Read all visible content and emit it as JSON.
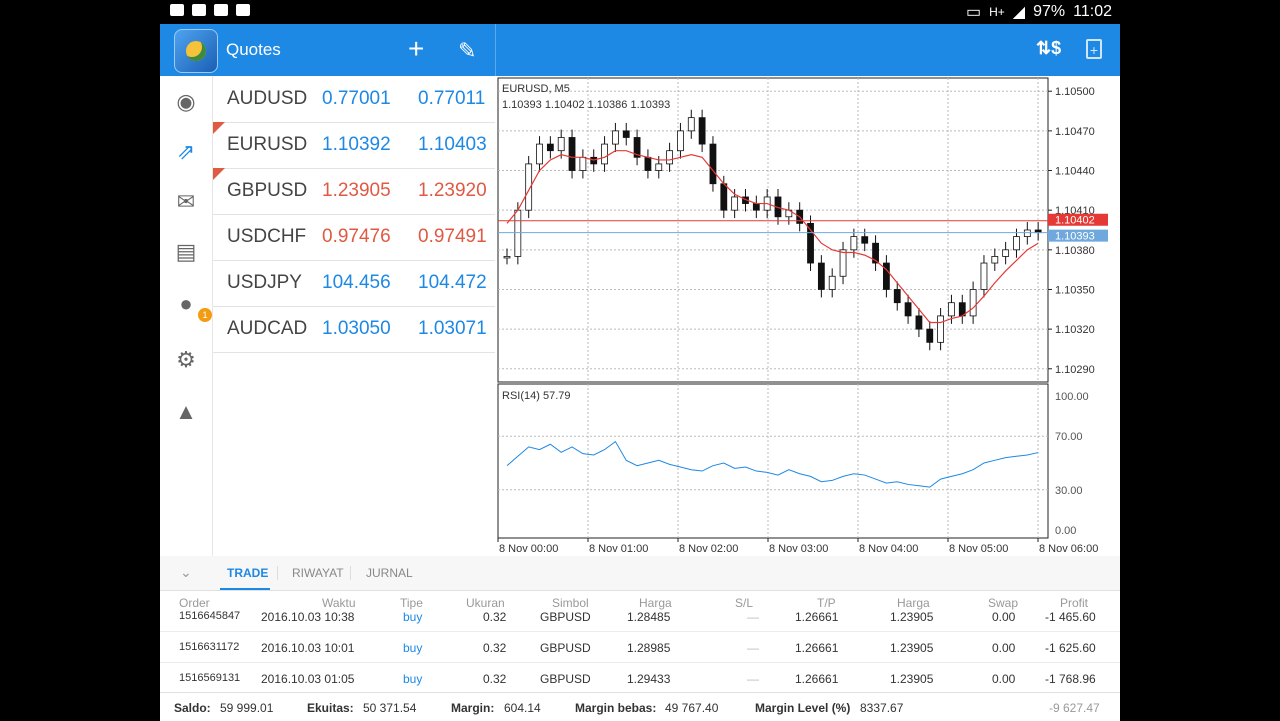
{
  "status_bar": {
    "battery": "97%",
    "time": "11:02",
    "network": "H+"
  },
  "app_bar": {
    "title": "Quotes"
  },
  "nav_badge": "1",
  "quotes": [
    {
      "symbol": "AUDUSD",
      "bid": "0.77001",
      "ask": "0.77011",
      "color": "#1e88e5",
      "flag": false
    },
    {
      "symbol": "EURUSD",
      "bid": "1.10392",
      "ask": "1.10403",
      "color": "#1e88e5",
      "flag": true
    },
    {
      "symbol": "GBPUSD",
      "bid": "1.23905",
      "ask": "1.23920",
      "color": "#e05a43",
      "flag": true
    },
    {
      "symbol": "USDCHF",
      "bid": "0.97476",
      "ask": "0.97491",
      "color": "#e05a43",
      "flag": false
    },
    {
      "symbol": "USDJPY",
      "bid": "104.456",
      "ask": "104.472",
      "color": "#1e88e5",
      "flag": false
    },
    {
      "symbol": "AUDCAD",
      "bid": "1.03050",
      "ask": "1.03071",
      "color": "#1e88e5",
      "flag": false
    }
  ],
  "chart": {
    "symbol_tf": "EURUSD, M5",
    "ohlc": "1.10393 1.10402 1.10386 1.10393",
    "price_ticks": [
      "1.10500",
      "1.10470",
      "1.10440",
      "1.10410",
      "1.10380",
      "1.10350",
      "1.10320",
      "1.10290"
    ],
    "ask_label": "1.10402",
    "bid_label": "1.10393",
    "rsi_label": "RSI(14) 57.79",
    "rsi_ticks": [
      "100.00",
      "70.00",
      "30.00",
      "0.00"
    ],
    "time_ticks": [
      "8 Nov 00:00",
      "8 Nov 01:00",
      "8 Nov 02:00",
      "8 Nov 03:00",
      "8 Nov 04:00",
      "8 Nov 05:00",
      "8 Nov 06:00"
    ]
  },
  "chart_data": {
    "type": "line",
    "title": "EURUSD, M5",
    "ylim": [
      1.1028,
      1.1051
    ],
    "close_prices": [
      1.10375,
      1.1041,
      1.10445,
      1.1046,
      1.10455,
      1.10465,
      1.1044,
      1.1045,
      1.10445,
      1.1046,
      1.1047,
      1.10465,
      1.1045,
      1.1044,
      1.10445,
      1.10455,
      1.1047,
      1.1048,
      1.1046,
      1.1043,
      1.1041,
      1.1042,
      1.10415,
      1.1041,
      1.1042,
      1.10405,
      1.1041,
      1.104,
      1.1037,
      1.1035,
      1.1036,
      1.1038,
      1.1039,
      1.10385,
      1.1037,
      1.1035,
      1.1034,
      1.1033,
      1.1032,
      1.1031,
      1.1033,
      1.1034,
      1.1033,
      1.1035,
      1.1037,
      1.10375,
      1.1038,
      1.1039,
      1.10395,
      1.10393
    ],
    "ma_prices": [
      1.104,
      1.1041,
      1.10425,
      1.1044,
      1.10448,
      1.10452,
      1.1045,
      1.1045,
      1.10448,
      1.1045,
      1.10455,
      1.10455,
      1.10452,
      1.1045,
      1.10448,
      1.10448,
      1.1045,
      1.10452,
      1.1045,
      1.1044,
      1.1043,
      1.10422,
      1.10418,
      1.10415,
      1.10415,
      1.10412,
      1.1041,
      1.10405,
      1.10395,
      1.10385,
      1.1038,
      1.10378,
      1.10378,
      1.10376,
      1.10372,
      1.10365,
      1.10355,
      1.10345,
      1.10335,
      1.10325,
      1.10325,
      1.10328,
      1.1033,
      1.10336,
      1.10345,
      1.10355,
      1.10364,
      1.10372,
      1.1038,
      1.10385
    ],
    "rsi": [
      48,
      55,
      62,
      60,
      64,
      58,
      62,
      57,
      56,
      60,
      66,
      52,
      48,
      50,
      52,
      49,
      47,
      45,
      44,
      48,
      50,
      46,
      47,
      44,
      43,
      41,
      45,
      42,
      40,
      36,
      37,
      40,
      42,
      41,
      38,
      35,
      36,
      34,
      33,
      32,
      38,
      40,
      42,
      45,
      50,
      52,
      54,
      55,
      56,
      57.79
    ],
    "rsi_ylim": [
      0,
      100
    ],
    "x_labels": [
      "8 Nov 00:00",
      "8 Nov 01:00",
      "8 Nov 02:00",
      "8 Nov 03:00",
      "8 Nov 04:00",
      "8 Nov 05:00",
      "8 Nov 06:00"
    ]
  },
  "bottom_tabs": [
    "TRADE",
    "RIWAYAT",
    "JURNAL"
  ],
  "table": {
    "headers": [
      "Order",
      "Waktu",
      "Tipe",
      "Ukuran",
      "Simbol",
      "Harga",
      "S/L",
      "T/P",
      "Harga",
      "Swap",
      "Profit"
    ],
    "rows": [
      [
        "1516645847",
        "2016.10.03 10:38",
        "buy",
        "0.32",
        "GBPUSD",
        "1.28485",
        "—",
        "1.26661",
        "1.23905",
        "0.00",
        "-1 465.60"
      ],
      [
        "1516631172",
        "2016.10.03 10:01",
        "buy",
        "0.32",
        "GBPUSD",
        "1.28985",
        "—",
        "1.26661",
        "1.23905",
        "0.00",
        "-1 625.60"
      ],
      [
        "1516569131",
        "2016.10.03 01:05",
        "buy",
        "0.32",
        "GBPUSD",
        "1.29433",
        "—",
        "1.26661",
        "1.23905",
        "0.00",
        "-1 768.96"
      ]
    ]
  },
  "footer": {
    "saldo_label": "Saldo:",
    "saldo": "59 999.01",
    "ekuitas_label": "Ekuitas:",
    "ekuitas": "50 371.54",
    "margin_label": "Margin:",
    "margin": "604.14",
    "margin_bebas_label": "Margin bebas:",
    "margin_bebas": "49 767.40",
    "margin_level_label": "Margin Level (%)",
    "margin_level": "8337.67",
    "total_profit": "-9 627.47"
  }
}
